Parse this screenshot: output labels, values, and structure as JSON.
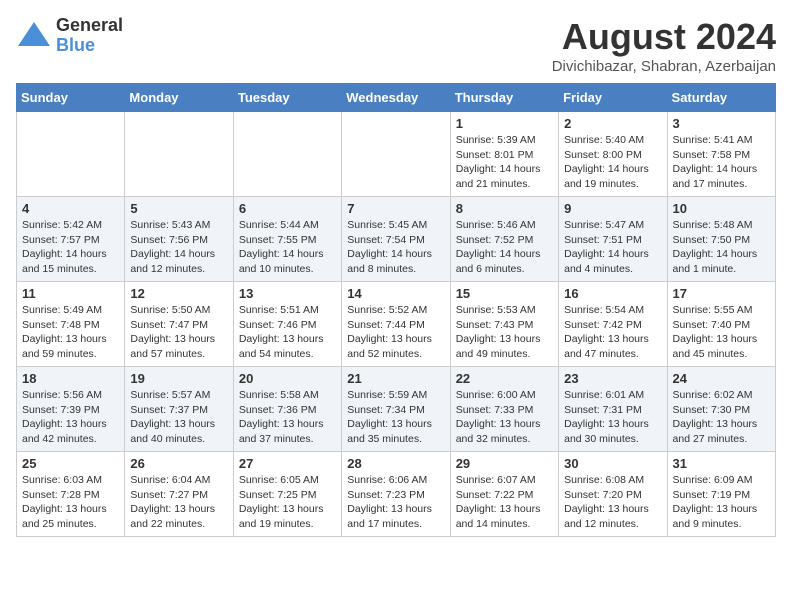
{
  "logo": {
    "general": "General",
    "blue": "Blue"
  },
  "title": "August 2024",
  "location": "Divichibazar, Shabran, Azerbaijan",
  "headers": [
    "Sunday",
    "Monday",
    "Tuesday",
    "Wednesday",
    "Thursday",
    "Friday",
    "Saturday"
  ],
  "weeks": [
    [
      {
        "day": "",
        "details": ""
      },
      {
        "day": "",
        "details": ""
      },
      {
        "day": "",
        "details": ""
      },
      {
        "day": "",
        "details": ""
      },
      {
        "day": "1",
        "details": "Sunrise: 5:39 AM\nSunset: 8:01 PM\nDaylight: 14 hours\nand 21 minutes."
      },
      {
        "day": "2",
        "details": "Sunrise: 5:40 AM\nSunset: 8:00 PM\nDaylight: 14 hours\nand 19 minutes."
      },
      {
        "day": "3",
        "details": "Sunrise: 5:41 AM\nSunset: 7:58 PM\nDaylight: 14 hours\nand 17 minutes."
      }
    ],
    [
      {
        "day": "4",
        "details": "Sunrise: 5:42 AM\nSunset: 7:57 PM\nDaylight: 14 hours\nand 15 minutes."
      },
      {
        "day": "5",
        "details": "Sunrise: 5:43 AM\nSunset: 7:56 PM\nDaylight: 14 hours\nand 12 minutes."
      },
      {
        "day": "6",
        "details": "Sunrise: 5:44 AM\nSunset: 7:55 PM\nDaylight: 14 hours\nand 10 minutes."
      },
      {
        "day": "7",
        "details": "Sunrise: 5:45 AM\nSunset: 7:54 PM\nDaylight: 14 hours\nand 8 minutes."
      },
      {
        "day": "8",
        "details": "Sunrise: 5:46 AM\nSunset: 7:52 PM\nDaylight: 14 hours\nand 6 minutes."
      },
      {
        "day": "9",
        "details": "Sunrise: 5:47 AM\nSunset: 7:51 PM\nDaylight: 14 hours\nand 4 minutes."
      },
      {
        "day": "10",
        "details": "Sunrise: 5:48 AM\nSunset: 7:50 PM\nDaylight: 14 hours\nand 1 minute."
      }
    ],
    [
      {
        "day": "11",
        "details": "Sunrise: 5:49 AM\nSunset: 7:48 PM\nDaylight: 13 hours\nand 59 minutes."
      },
      {
        "day": "12",
        "details": "Sunrise: 5:50 AM\nSunset: 7:47 PM\nDaylight: 13 hours\nand 57 minutes."
      },
      {
        "day": "13",
        "details": "Sunrise: 5:51 AM\nSunset: 7:46 PM\nDaylight: 13 hours\nand 54 minutes."
      },
      {
        "day": "14",
        "details": "Sunrise: 5:52 AM\nSunset: 7:44 PM\nDaylight: 13 hours\nand 52 minutes."
      },
      {
        "day": "15",
        "details": "Sunrise: 5:53 AM\nSunset: 7:43 PM\nDaylight: 13 hours\nand 49 minutes."
      },
      {
        "day": "16",
        "details": "Sunrise: 5:54 AM\nSunset: 7:42 PM\nDaylight: 13 hours\nand 47 minutes."
      },
      {
        "day": "17",
        "details": "Sunrise: 5:55 AM\nSunset: 7:40 PM\nDaylight: 13 hours\nand 45 minutes."
      }
    ],
    [
      {
        "day": "18",
        "details": "Sunrise: 5:56 AM\nSunset: 7:39 PM\nDaylight: 13 hours\nand 42 minutes."
      },
      {
        "day": "19",
        "details": "Sunrise: 5:57 AM\nSunset: 7:37 PM\nDaylight: 13 hours\nand 40 minutes."
      },
      {
        "day": "20",
        "details": "Sunrise: 5:58 AM\nSunset: 7:36 PM\nDaylight: 13 hours\nand 37 minutes."
      },
      {
        "day": "21",
        "details": "Sunrise: 5:59 AM\nSunset: 7:34 PM\nDaylight: 13 hours\nand 35 minutes."
      },
      {
        "day": "22",
        "details": "Sunrise: 6:00 AM\nSunset: 7:33 PM\nDaylight: 13 hours\nand 32 minutes."
      },
      {
        "day": "23",
        "details": "Sunrise: 6:01 AM\nSunset: 7:31 PM\nDaylight: 13 hours\nand 30 minutes."
      },
      {
        "day": "24",
        "details": "Sunrise: 6:02 AM\nSunset: 7:30 PM\nDaylight: 13 hours\nand 27 minutes."
      }
    ],
    [
      {
        "day": "25",
        "details": "Sunrise: 6:03 AM\nSunset: 7:28 PM\nDaylight: 13 hours\nand 25 minutes."
      },
      {
        "day": "26",
        "details": "Sunrise: 6:04 AM\nSunset: 7:27 PM\nDaylight: 13 hours\nand 22 minutes."
      },
      {
        "day": "27",
        "details": "Sunrise: 6:05 AM\nSunset: 7:25 PM\nDaylight: 13 hours\nand 19 minutes."
      },
      {
        "day": "28",
        "details": "Sunrise: 6:06 AM\nSunset: 7:23 PM\nDaylight: 13 hours\nand 17 minutes."
      },
      {
        "day": "29",
        "details": "Sunrise: 6:07 AM\nSunset: 7:22 PM\nDaylight: 13 hours\nand 14 minutes."
      },
      {
        "day": "30",
        "details": "Sunrise: 6:08 AM\nSunset: 7:20 PM\nDaylight: 13 hours\nand 12 minutes."
      },
      {
        "day": "31",
        "details": "Sunrise: 6:09 AM\nSunset: 7:19 PM\nDaylight: 13 hours\nand 9 minutes."
      }
    ]
  ]
}
